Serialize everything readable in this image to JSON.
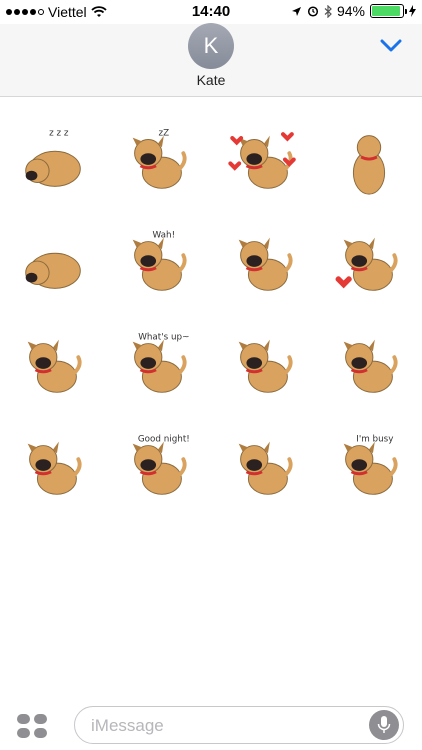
{
  "status_bar": {
    "carrier": "Viettel",
    "time": "14:40",
    "battery_percent": "94%",
    "battery_level": 0.94,
    "signal_bars": 4,
    "signal_total": 5,
    "icons": [
      "wifi-icon",
      "location-icon",
      "alarm-icon",
      "bluetooth-icon",
      "battery-icon",
      "charging-icon"
    ]
  },
  "header": {
    "avatar_initial": "K",
    "contact_name": "Kate",
    "collapse_icon": "chevron-down-icon"
  },
  "stickers": [
    {
      "pose": "curl",
      "caption": "z z z"
    },
    {
      "pose": "sit",
      "caption": "zZ"
    },
    {
      "pose": "sit",
      "caption": "hearts"
    },
    {
      "pose": "back",
      "caption": ""
    },
    {
      "pose": "roll",
      "caption": ""
    },
    {
      "pose": "sit",
      "caption": "Wah!"
    },
    {
      "pose": "stand",
      "caption": ""
    },
    {
      "pose": "stand",
      "caption": "broken-heart"
    },
    {
      "pose": "sit",
      "caption": ""
    },
    {
      "pose": "sit",
      "caption": "What's up~"
    },
    {
      "pose": "play",
      "caption": ""
    },
    {
      "pose": "stand",
      "caption": ""
    },
    {
      "pose": "stand",
      "caption": ""
    },
    {
      "pose": "stand",
      "caption": "Good night!"
    },
    {
      "pose": "stand",
      "caption": ""
    },
    {
      "pose": "play",
      "caption": "I'm busy"
    }
  ],
  "composer": {
    "placeholder": "iMessage",
    "apps_icon": "app-drawer-icon",
    "mic_icon": "microphone-icon"
  },
  "colors": {
    "dog_fur": "#d9a25e",
    "dog_muzzle": "#2b2120",
    "collar": "#d32f2f",
    "accent": "#1a73e8",
    "battery": "#4cd964"
  }
}
